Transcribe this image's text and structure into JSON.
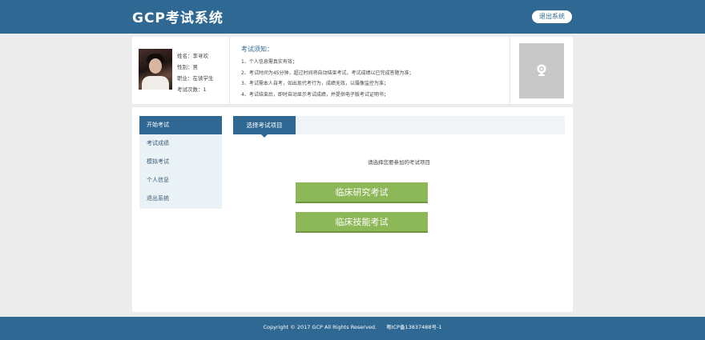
{
  "header": {
    "logo": "GCP考试系统",
    "logout_label": "退出系统"
  },
  "user": {
    "name": "姓名：李寻欢",
    "gender": "性别：男",
    "occupation": "职业：在读学生",
    "exam_count": "考试次数：1"
  },
  "notice": {
    "title": "考试须知：",
    "items": [
      "1、个人信息需真实有效；",
      "2、考试时间为45分钟，超过时间将自动结束考试，考试成绩以已完成答题为准；",
      "3、考试需本人自考，如出现代考行为，成绩无效，以摄像监控为准；",
      "4、考试结束后，即时自动显示考试成绩，并提供电子版考试证明书；"
    ]
  },
  "sidebar": {
    "items": [
      {
        "label": "开始考试"
      },
      {
        "label": "考试成绩"
      },
      {
        "label": "模拟考试"
      },
      {
        "label": "个人信息"
      },
      {
        "label": "退出系统"
      }
    ]
  },
  "main": {
    "tab_label": "选择考试项目",
    "prompt": "请选择您要参加的考试项目",
    "exam_buttons": [
      "临床研究考试",
      "临床技能考试"
    ]
  },
  "footer": {
    "copyright": "Copyright © 2017 GCP All Rights Reserved.",
    "icp": "粤ICP备13837488号-1"
  },
  "colors": {
    "primary": "#2f6893",
    "button_green": "#8db857",
    "sidebar_bg": "#e9f2f7"
  },
  "icons": {
    "photo_placeholder": "camera-icon"
  }
}
